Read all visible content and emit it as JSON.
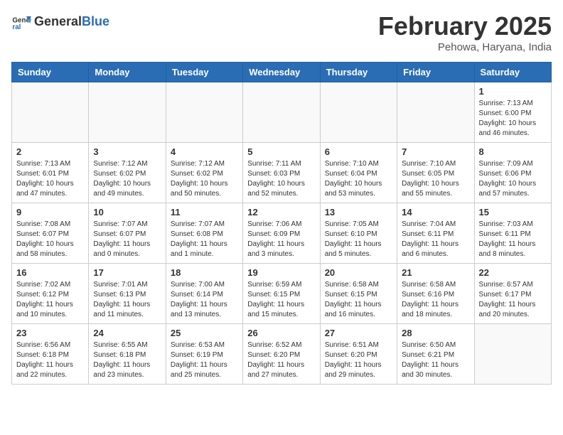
{
  "header": {
    "logo_general": "General",
    "logo_blue": "Blue",
    "title": "February 2025",
    "location": "Pehowa, Haryana, India"
  },
  "weekdays": [
    "Sunday",
    "Monday",
    "Tuesday",
    "Wednesday",
    "Thursday",
    "Friday",
    "Saturday"
  ],
  "weeks": [
    [
      {
        "day": "",
        "info": ""
      },
      {
        "day": "",
        "info": ""
      },
      {
        "day": "",
        "info": ""
      },
      {
        "day": "",
        "info": ""
      },
      {
        "day": "",
        "info": ""
      },
      {
        "day": "",
        "info": ""
      },
      {
        "day": "1",
        "info": "Sunrise: 7:13 AM\nSunset: 6:00 PM\nDaylight: 10 hours and 46 minutes."
      }
    ],
    [
      {
        "day": "2",
        "info": "Sunrise: 7:13 AM\nSunset: 6:01 PM\nDaylight: 10 hours and 47 minutes."
      },
      {
        "day": "3",
        "info": "Sunrise: 7:12 AM\nSunset: 6:02 PM\nDaylight: 10 hours and 49 minutes."
      },
      {
        "day": "4",
        "info": "Sunrise: 7:12 AM\nSunset: 6:02 PM\nDaylight: 10 hours and 50 minutes."
      },
      {
        "day": "5",
        "info": "Sunrise: 7:11 AM\nSunset: 6:03 PM\nDaylight: 10 hours and 52 minutes."
      },
      {
        "day": "6",
        "info": "Sunrise: 7:10 AM\nSunset: 6:04 PM\nDaylight: 10 hours and 53 minutes."
      },
      {
        "day": "7",
        "info": "Sunrise: 7:10 AM\nSunset: 6:05 PM\nDaylight: 10 hours and 55 minutes."
      },
      {
        "day": "8",
        "info": "Sunrise: 7:09 AM\nSunset: 6:06 PM\nDaylight: 10 hours and 57 minutes."
      }
    ],
    [
      {
        "day": "9",
        "info": "Sunrise: 7:08 AM\nSunset: 6:07 PM\nDaylight: 10 hours and 58 minutes."
      },
      {
        "day": "10",
        "info": "Sunrise: 7:07 AM\nSunset: 6:07 PM\nDaylight: 11 hours and 0 minutes."
      },
      {
        "day": "11",
        "info": "Sunrise: 7:07 AM\nSunset: 6:08 PM\nDaylight: 11 hours and 1 minute."
      },
      {
        "day": "12",
        "info": "Sunrise: 7:06 AM\nSunset: 6:09 PM\nDaylight: 11 hours and 3 minutes."
      },
      {
        "day": "13",
        "info": "Sunrise: 7:05 AM\nSunset: 6:10 PM\nDaylight: 11 hours and 5 minutes."
      },
      {
        "day": "14",
        "info": "Sunrise: 7:04 AM\nSunset: 6:11 PM\nDaylight: 11 hours and 6 minutes."
      },
      {
        "day": "15",
        "info": "Sunrise: 7:03 AM\nSunset: 6:11 PM\nDaylight: 11 hours and 8 minutes."
      }
    ],
    [
      {
        "day": "16",
        "info": "Sunrise: 7:02 AM\nSunset: 6:12 PM\nDaylight: 11 hours and 10 minutes."
      },
      {
        "day": "17",
        "info": "Sunrise: 7:01 AM\nSunset: 6:13 PM\nDaylight: 11 hours and 11 minutes."
      },
      {
        "day": "18",
        "info": "Sunrise: 7:00 AM\nSunset: 6:14 PM\nDaylight: 11 hours and 13 minutes."
      },
      {
        "day": "19",
        "info": "Sunrise: 6:59 AM\nSunset: 6:15 PM\nDaylight: 11 hours and 15 minutes."
      },
      {
        "day": "20",
        "info": "Sunrise: 6:58 AM\nSunset: 6:15 PM\nDaylight: 11 hours and 16 minutes."
      },
      {
        "day": "21",
        "info": "Sunrise: 6:58 AM\nSunset: 6:16 PM\nDaylight: 11 hours and 18 minutes."
      },
      {
        "day": "22",
        "info": "Sunrise: 6:57 AM\nSunset: 6:17 PM\nDaylight: 11 hours and 20 minutes."
      }
    ],
    [
      {
        "day": "23",
        "info": "Sunrise: 6:56 AM\nSunset: 6:18 PM\nDaylight: 11 hours and 22 minutes."
      },
      {
        "day": "24",
        "info": "Sunrise: 6:55 AM\nSunset: 6:18 PM\nDaylight: 11 hours and 23 minutes."
      },
      {
        "day": "25",
        "info": "Sunrise: 6:53 AM\nSunset: 6:19 PM\nDaylight: 11 hours and 25 minutes."
      },
      {
        "day": "26",
        "info": "Sunrise: 6:52 AM\nSunset: 6:20 PM\nDaylight: 11 hours and 27 minutes."
      },
      {
        "day": "27",
        "info": "Sunrise: 6:51 AM\nSunset: 6:20 PM\nDaylight: 11 hours and 29 minutes."
      },
      {
        "day": "28",
        "info": "Sunrise: 6:50 AM\nSunset: 6:21 PM\nDaylight: 11 hours and 30 minutes."
      },
      {
        "day": "",
        "info": ""
      }
    ]
  ]
}
